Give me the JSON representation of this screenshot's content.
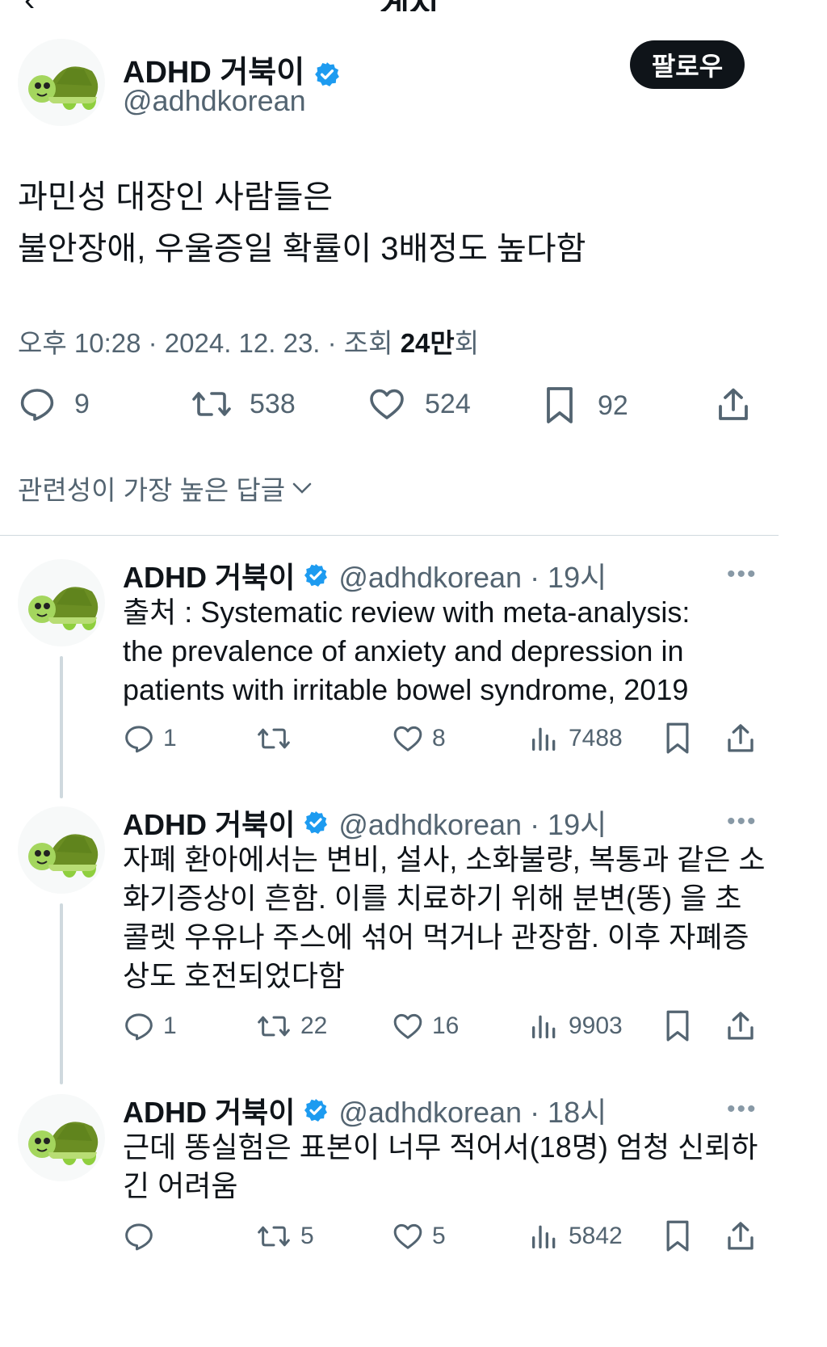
{
  "header": {
    "title": "게시"
  },
  "tweet": {
    "author_name": "ADHD 거북이",
    "handle": "@adhdkorean",
    "follow_label": "팔로우",
    "text": "과민성 대장인 사람들은\n불안장애, 우울증일 확률이 3배정도 높다함",
    "meta_time": "오후 10:28 · 2024. 12. 23. · 조회 ",
    "meta_views": "24만",
    "meta_views_suffix": "회",
    "stats": {
      "replies": "9",
      "retweets": "538",
      "likes": "524",
      "bookmarks": "92"
    }
  },
  "sort_label": "관련성이 가장 높은 답글",
  "replies": [
    {
      "name": "ADHD 거북이",
      "handle": "@adhdkorean · 19시",
      "text": "출처 : Systematic review with meta-analysis:\nthe prevalence of anxiety and depression in\npatients with irritable bowel syndrome, 2019",
      "replies": "1",
      "retweets": "",
      "likes": "8",
      "views": "7488"
    },
    {
      "name": "ADHD 거북이",
      "handle": "@adhdkorean · 19시",
      "text": "자폐 환아에서는 변비, 설사, 소화불량, 복통과 같은 소\n화기증상이 흔함. 이를 치료하기 위해 분변(똥) 을 초\n콜렛 우유나 주스에 섞어 먹거나 관장함. 이후 자폐증\n상도 호전되었다함",
      "replies": "1",
      "retweets": "22",
      "likes": "16",
      "views": "9903"
    },
    {
      "name": "ADHD 거북이",
      "handle": "@adhdkorean · 18시",
      "text": "근데 똥실험은 표본이 너무 적어서(18명) 엄청 신뢰하\n긴 어려움",
      "replies": "",
      "retweets": "5",
      "likes": "5",
      "views": "5842"
    }
  ],
  "colors": {
    "accent": "#1d9bf0",
    "text": "#0f1419",
    "secondary": "#536471",
    "turtle_shell": "#6b8e23",
    "turtle_body": "#a4d65e"
  },
  "icons": [
    "back-arrow-icon",
    "verified-badge-icon",
    "reply-icon",
    "retweet-icon",
    "like-icon",
    "bookmark-icon",
    "share-icon",
    "views-icon",
    "chevron-down-icon",
    "more-icon",
    "turtle-avatar-icon"
  ]
}
